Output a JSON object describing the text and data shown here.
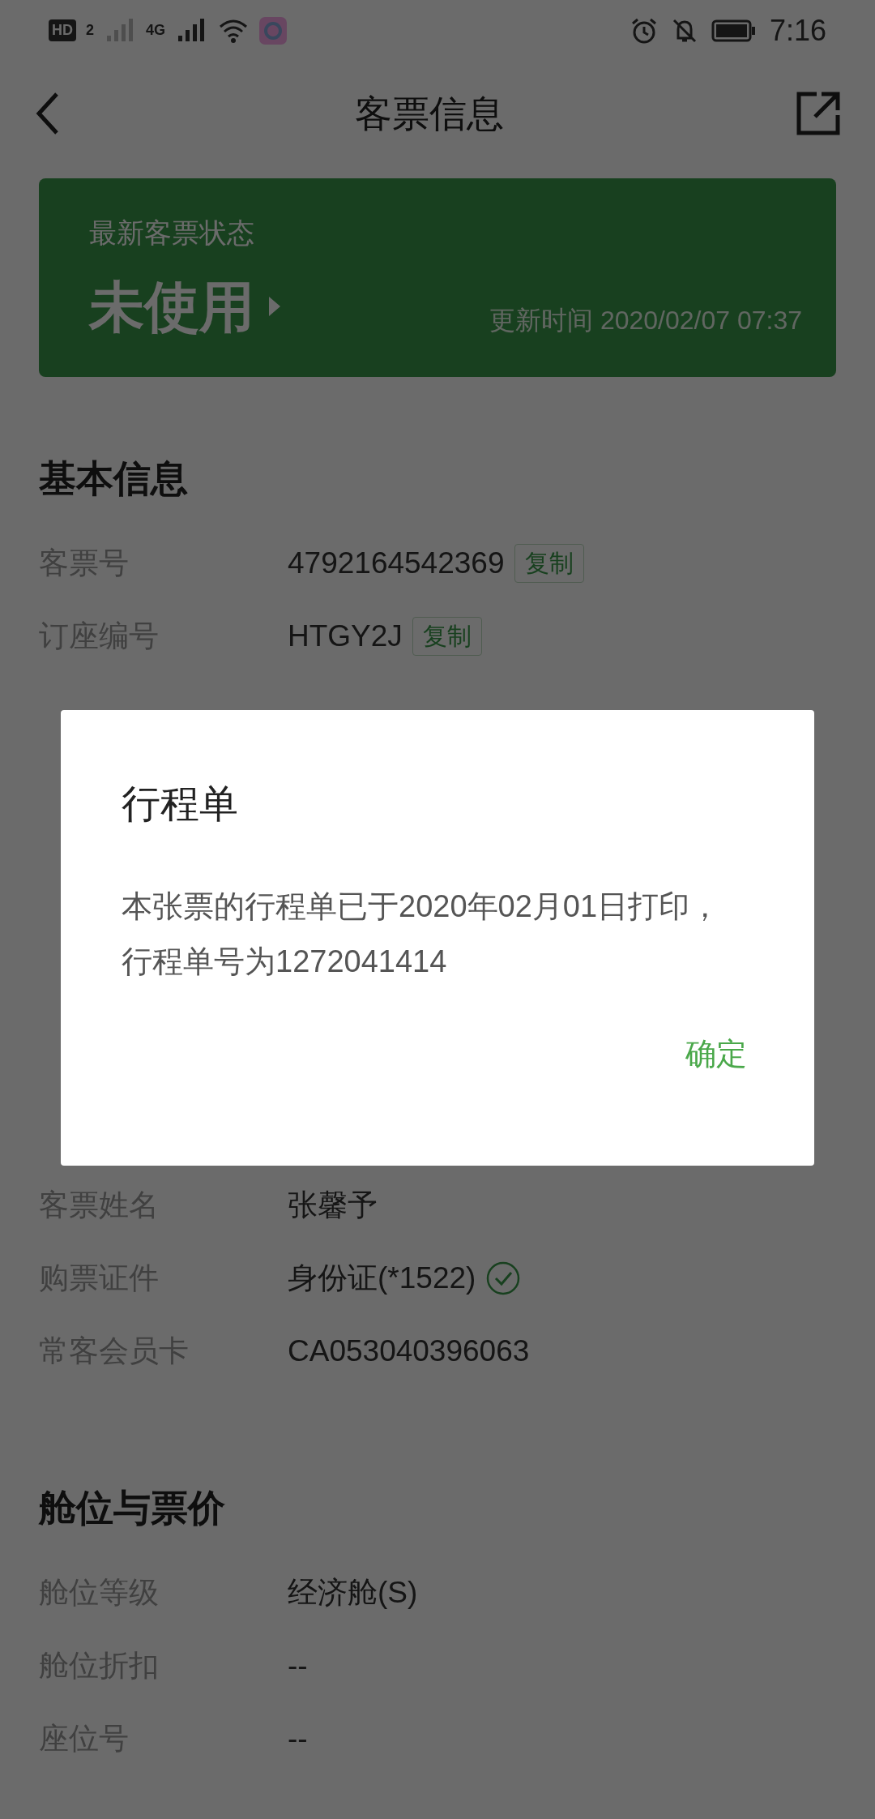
{
  "status_bar": {
    "hd": "HD",
    "sim": "2",
    "network": "4G",
    "time": "7:16"
  },
  "header": {
    "title": "客票信息"
  },
  "status_card": {
    "label": "最新客票状态",
    "status": "未使用",
    "updated": "更新时间 2020/02/07 07:37"
  },
  "sections": [
    {
      "title": "基本信息",
      "rows": [
        {
          "label": "客票号",
          "value": "4792164542369",
          "action": "复制",
          "kind": "copy"
        },
        {
          "label": "订座编号",
          "value": "HTGY2J",
          "action": "复制",
          "kind": "copy"
        }
      ]
    },
    {
      "rows": [
        {
          "label": "客票姓名",
          "value": "张馨予",
          "kind": "plain"
        },
        {
          "label": "购票证件",
          "value": "身份证(*1522)",
          "kind": "verified"
        },
        {
          "label": "常客会员卡",
          "value": "CA053040396063",
          "kind": "plain"
        }
      ]
    },
    {
      "title": "舱位与票价",
      "rows": [
        {
          "label": "舱位等级",
          "value": "经济舱(S)",
          "kind": "plain"
        },
        {
          "label": "舱位折扣",
          "value": "--",
          "kind": "plain"
        },
        {
          "label": "座位号",
          "value": "--",
          "kind": "plain"
        }
      ]
    }
  ],
  "dialog": {
    "title": "行程单",
    "message": "本张票的行程单已于2020年02月01日打印，行程单号为1272041414",
    "button": "确定"
  }
}
